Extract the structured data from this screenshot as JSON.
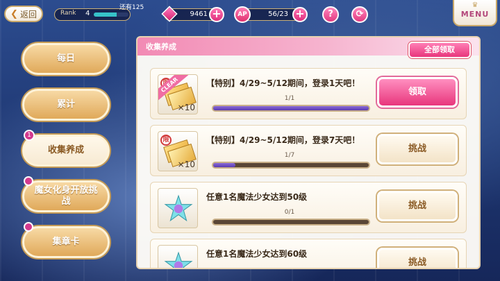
{
  "topbar": {
    "back_label": "返回",
    "rank_label": "Rank",
    "rank_value": "4",
    "rank_progress": 0.65,
    "remain_label": "还有125",
    "gems": "9461",
    "ap_label": "AP",
    "ap_value": "56/23",
    "help_glyph": "?",
    "menu_label": "MENU"
  },
  "sidebar": {
    "items": [
      {
        "label": "每日"
      },
      {
        "label": "累计"
      },
      {
        "label": "收集养成",
        "badge": "1"
      },
      {
        "label": "魔女化身开放挑战"
      },
      {
        "label": "集章卡"
      }
    ]
  },
  "panel": {
    "title": "收集养成",
    "claim_all": "全部领取",
    "tasks": [
      {
        "title": "【特别】4/29~5/12期间，登录1天吧！",
        "progress": "1/1",
        "ratio": 1.0,
        "qty": "×10",
        "clear": "CLEAR",
        "limit": "限",
        "button": "领取",
        "icon": "ticket-icon"
      },
      {
        "title": "【特别】4/29~5/12期间，登录7天吧！",
        "progress": "1/7",
        "ratio": 0.143,
        "qty": "×10",
        "limit": "限",
        "button": "挑战",
        "icon": "ticket-icon"
      },
      {
        "title": "任意1名魔法少女达到50级",
        "progress": "0/1",
        "ratio": 0.0,
        "button": "挑战",
        "icon": "crystal-star-icon"
      },
      {
        "title": "任意1名魔法少女达到60级",
        "button": "挑战",
        "icon": "crystal-star-icon"
      }
    ]
  }
}
